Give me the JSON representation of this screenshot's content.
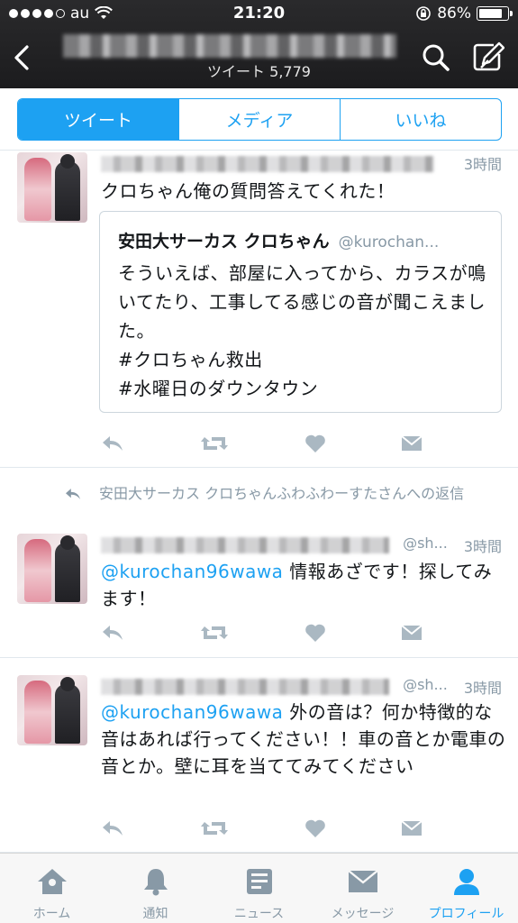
{
  "status": {
    "carrier": "au",
    "time": "21:20",
    "battery": "86%",
    "battery_level": 0.86
  },
  "nav": {
    "tweet_count": "ツイート 5,779"
  },
  "tabs": [
    {
      "label": "ツイート",
      "active": true
    },
    {
      "label": "メディア",
      "active": false
    },
    {
      "label": "いいね",
      "active": false
    }
  ],
  "tweets": [
    {
      "handle": "",
      "time": "3時間",
      "text": "クロちゃん俺の質問答えてくれた！",
      "quote": {
        "name": "安田大サーカス クロちゃん",
        "handle": "@kurochan...",
        "text": "そういえば、部屋に入ってから、カラスが鳴いてたり、工事してる感じの音が聞こえました。\n#クロちゃん救出\n#水曜日のダウンタウン"
      }
    },
    {
      "reply_context": "安田大サーカス クロちゃんふわふわーすたさんへの返信",
      "handle": "@sh...",
      "time": "3時間",
      "mention": "@kurochan96wawa",
      "text": " 情報あざです！探してみます！"
    },
    {
      "handle": "@sh...",
      "time": "3時間",
      "mention": "@kurochan96wawa",
      "text": " 外の音は？何か特徴的な音はあれば行ってください！！車の音とか電車の音とか。壁に耳を当ててみてください"
    }
  ],
  "tabbar": [
    {
      "label": "ホーム",
      "icon": "home-icon",
      "active": false
    },
    {
      "label": "通知",
      "icon": "bell-icon",
      "active": false
    },
    {
      "label": "ニュース",
      "icon": "news-icon",
      "active": false
    },
    {
      "label": "メッセージ",
      "icon": "envelope-icon",
      "active": false
    },
    {
      "label": "プロフィール",
      "icon": "person-icon",
      "active": true
    }
  ],
  "colors": {
    "accent": "#1da1f2",
    "muted": "#8899a6",
    "header": "#1c1c1e"
  }
}
